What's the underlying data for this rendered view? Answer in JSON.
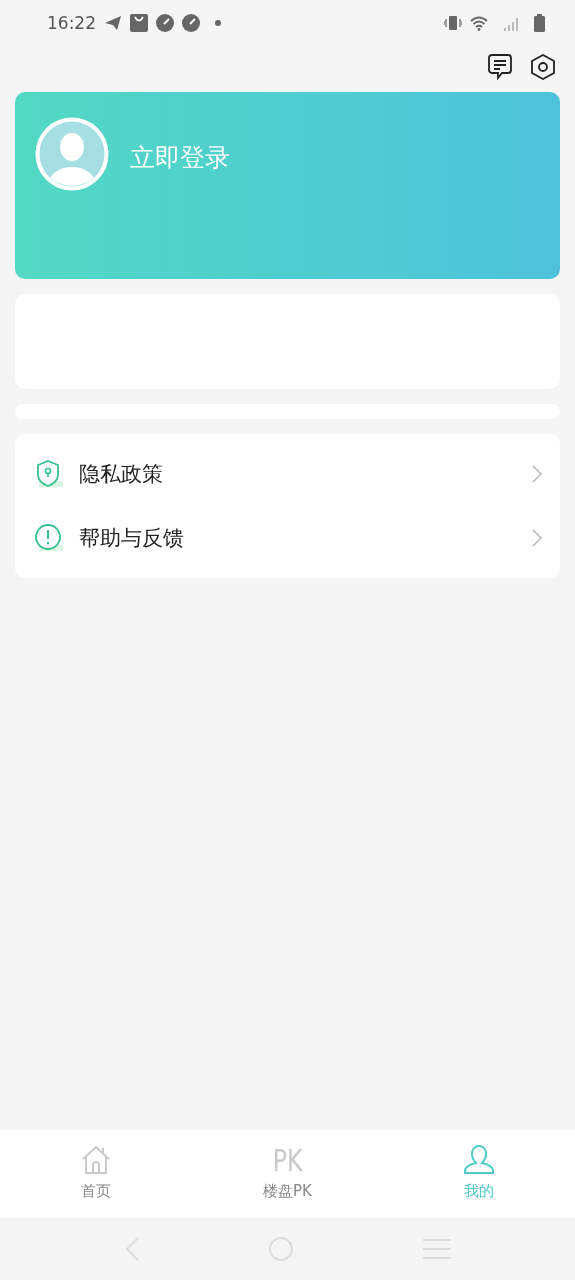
{
  "status_bar": {
    "time": "16:22"
  },
  "profile": {
    "login_label": "立即登录"
  },
  "menu": [
    {
      "kind": "shield",
      "label": "隐私政策"
    },
    {
      "kind": "alert",
      "label": "帮助与反馈"
    }
  ],
  "tabs": [
    {
      "kind": "home",
      "label": "首页",
      "selected": false
    },
    {
      "kind": "pk",
      "glyph": "PK",
      "label": "楼盘PK",
      "selected": false
    },
    {
      "kind": "user",
      "label": "我的",
      "selected": true
    }
  ]
}
